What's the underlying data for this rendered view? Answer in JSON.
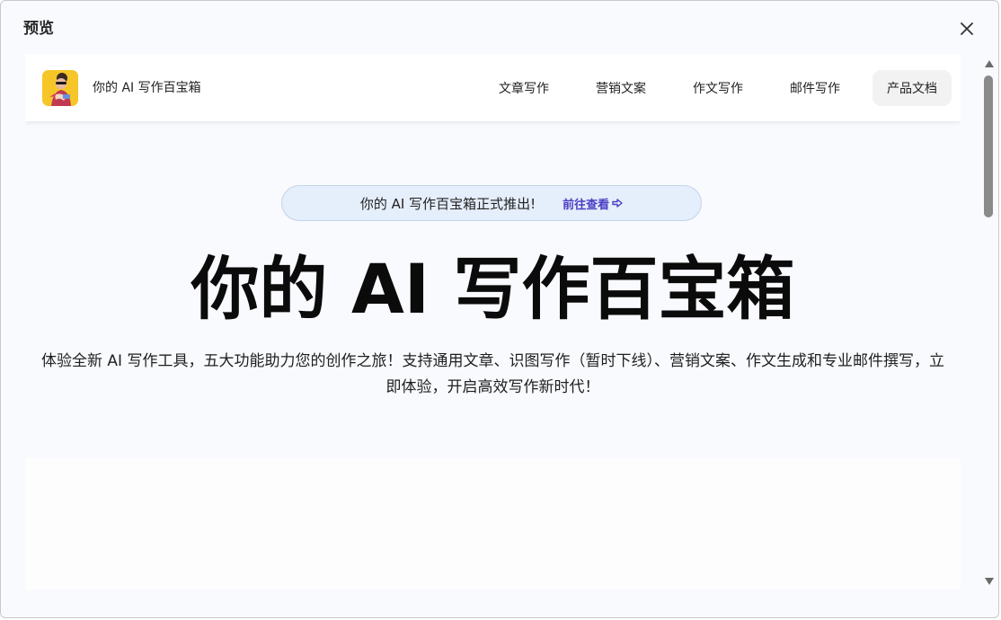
{
  "dialog": {
    "title": "预览"
  },
  "site": {
    "brand": "你的 AI 写作百宝箱",
    "nav": [
      {
        "label": "文章写作"
      },
      {
        "label": "营销文案"
      },
      {
        "label": "作文写作"
      },
      {
        "label": "邮件写作"
      },
      {
        "label": "产品文档"
      }
    ],
    "announce": {
      "text": "你的 AI 写作百宝箱正式推出!",
      "link": "前往查看"
    },
    "hero": {
      "title": "你的 AI 写作百宝箱",
      "description": "体验全新 AI 写作工具，五大功能助力您的创作之旅！支持通用文章、识图写作（暂时下线）、营销文案、作文生成和专业邮件撰写，立即体验，开启高效写作新时代！"
    }
  },
  "icons": {
    "close": "close-icon",
    "arrow": "arrow-right-icon",
    "scroll_up": "triangle-up-icon",
    "scroll_down": "triangle-down-icon"
  },
  "colors": {
    "accent_link": "#4a3fc4",
    "announce_bg": "#e5eefb",
    "logo_bg": "#f6c628"
  }
}
